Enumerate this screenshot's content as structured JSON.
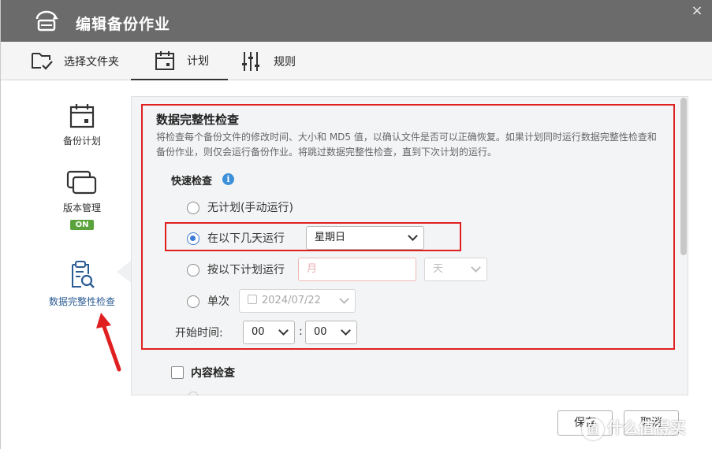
{
  "window": {
    "title": "编辑备份作业",
    "close_icon": "×"
  },
  "tabs": [
    {
      "label": "选择文件夹",
      "icon": "folder-check-icon"
    },
    {
      "label": "计划",
      "icon": "calendar-icon",
      "active": true
    },
    {
      "label": "规则",
      "icon": "sliders-icon"
    }
  ],
  "sidebar": {
    "items": [
      {
        "label": "备份计划",
        "icon": "calendar-icon"
      },
      {
        "label": "版本管理",
        "icon": "versions-icon",
        "badge": "ON"
      },
      {
        "label": "数据完整性检查",
        "icon": "clipboard-search-icon",
        "active": true
      }
    ]
  },
  "integrity": {
    "title": "数据完整性检查",
    "description": "将检查每个备份文件的修改时间、大小和 MD5 值，以确认文件是否可以正确恢复。如果计划同时运行数据完整性检查和备份作业，则仅会运行备份作业。将跳过数据完整性检查，直到下次计划的运行。",
    "quick_check_label": "快速检查",
    "info_icon": "i",
    "options": {
      "no_schedule": "无计划(手动运行)",
      "run_on_days": "在以下几天运行",
      "run_on_schedule": "按以下计划运行",
      "once": "单次"
    },
    "selected_option": "run_on_days",
    "day_select_value": "星期日",
    "month_placeholder": "月",
    "unit_select_value": "天",
    "date_value": "2024/07/22",
    "start_time_label": "开始时间:",
    "hour_value": "00",
    "minute_value": "00",
    "time_separator": ":",
    "content_check_label": "内容检查",
    "content_check_checked": false
  },
  "footer": {
    "save_label": "保存",
    "cancel_label": "取消"
  },
  "watermark": {
    "logo_text": "值",
    "text": "什么值得买"
  },
  "colors": {
    "titlebar": "#6b6b6b",
    "accent": "#3a7bd5",
    "badge_on": "#5aa33c",
    "annotation": "#e02020"
  }
}
